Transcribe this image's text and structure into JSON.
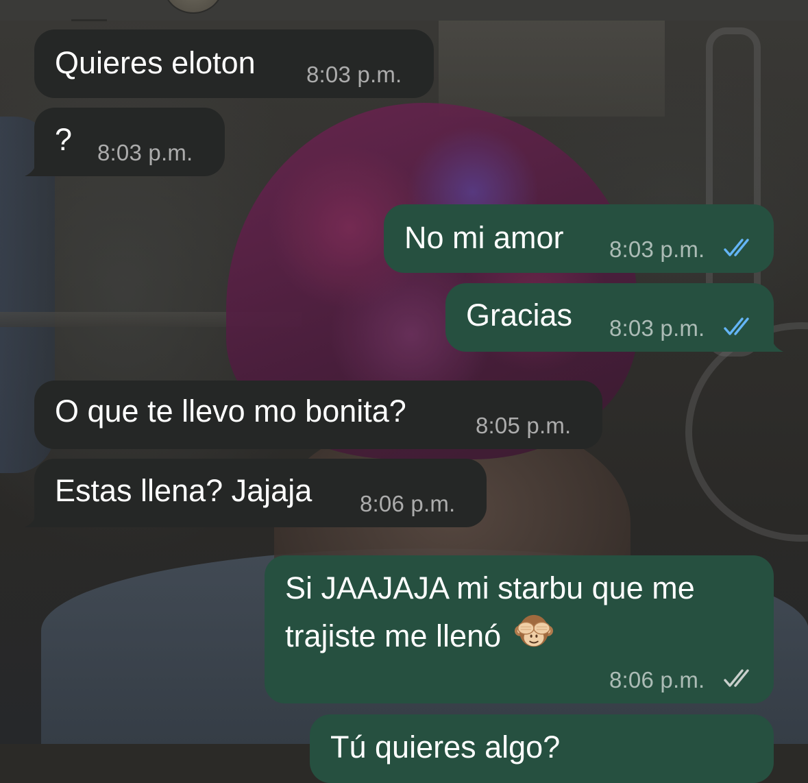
{
  "messages": [
    {
      "direction": "in",
      "text": "Quieres eloton",
      "time": "8:03 p.m."
    },
    {
      "direction": "in",
      "text": "?",
      "time": "8:03 p.m."
    },
    {
      "direction": "out",
      "text": "No mi amor",
      "time": "8:03 p.m.",
      "status": "read"
    },
    {
      "direction": "out",
      "text": "Gracias",
      "time": "8:03 p.m.",
      "status": "read"
    },
    {
      "direction": "in",
      "text": "O que te llevo mo bonita?",
      "time": "8:05 p.m."
    },
    {
      "direction": "in",
      "text": "Estas llena? Jajaja",
      "time": "8:06 p.m."
    },
    {
      "direction": "out",
      "text_line1": "Si JAAJAJA mi starbu que me",
      "text_line2": "trajiste me llenó",
      "emoji": "see-no-evil-monkey-icon",
      "time": "8:06 p.m.",
      "status": "delivered"
    },
    {
      "direction": "out",
      "text": "Tú quieres algo?",
      "time": ""
    }
  ],
  "colors": {
    "incoming_bubble": "#252726",
    "outgoing_bubble": "#265040",
    "read_ticks": "#64b5f6",
    "delivered_ticks": "#c9cfcc"
  }
}
